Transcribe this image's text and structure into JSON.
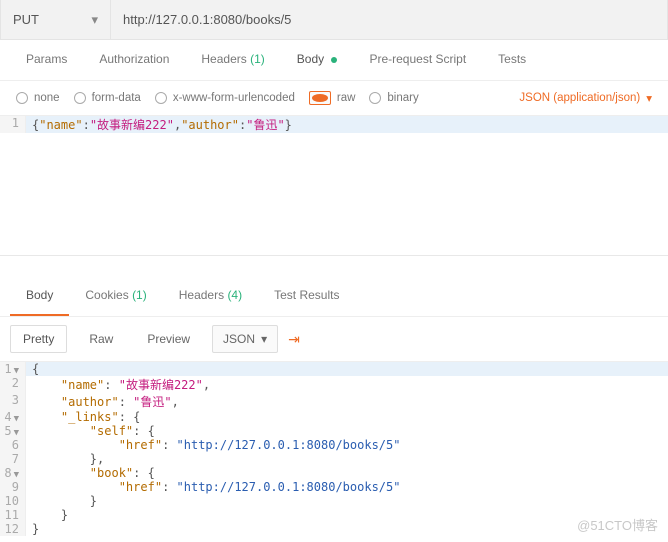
{
  "request": {
    "method": "PUT",
    "url": "http://127.0.0.1:8080/books/5",
    "tabs": {
      "params": "Params",
      "auth": "Authorization",
      "headers": "Headers",
      "headers_count": "(1)",
      "body": "Body",
      "prerequest": "Pre-request Script",
      "tests": "Tests"
    },
    "body_options": {
      "none": "none",
      "form": "form-data",
      "urlenc": "x-www-form-urlencoded",
      "raw": "raw",
      "binary": "binary",
      "content_type": "JSON (application/json)"
    },
    "body_json": {
      "line_no": "1",
      "brace_open": "{",
      "k1": "\"name\"",
      "c1": ":",
      "v1": "\"故事新编222\"",
      "comma": ",",
      "k2": "\"author\"",
      "c2": ":",
      "v2": "\"鲁迅\"",
      "brace_close": "}"
    }
  },
  "response": {
    "tabs": {
      "body": "Body",
      "cookies": "Cookies",
      "cookies_count": "(1)",
      "headers": "Headers",
      "headers_count": "(4)",
      "testresults": "Test Results"
    },
    "toolbar": {
      "pretty": "Pretty",
      "raw": "Raw",
      "preview": "Preview",
      "lang": "JSON"
    },
    "lines": {
      "n1": "1",
      "n2": "2",
      "n3": "3",
      "n4": "4",
      "n5": "5",
      "n6": "6",
      "n7": "7",
      "n8": "8",
      "n9": "9",
      "n10": "10",
      "n11": "11",
      "n12": "12",
      "brace": "{",
      "k_name": "\"name\"",
      "v_name": "\"故事新编222\"",
      "k_author": "\"author\"",
      "v_author": "\"鲁迅\"",
      "k_links": "\"_links\"",
      "k_self": "\"self\"",
      "k_href": "\"href\"",
      "v_href": "\"http://127.0.0.1:8080/books/5\"",
      "k_book": "\"book\"",
      "brace_c": "}",
      "brace_cc": "},",
      "comma": ","
    }
  },
  "watermark": "@51CTO博客"
}
